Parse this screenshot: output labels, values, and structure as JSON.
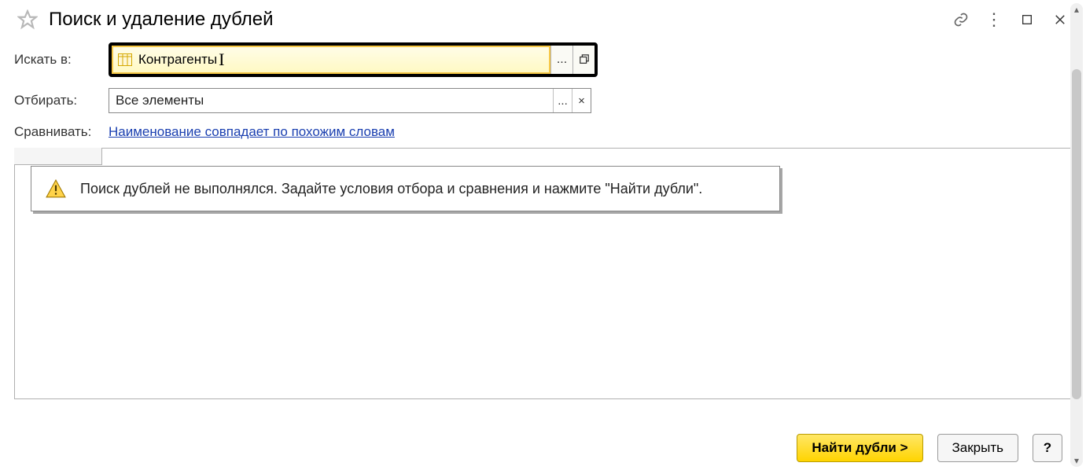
{
  "title": "Поиск и удаление дублей",
  "rows": {
    "search_in": {
      "label": "Искать в:",
      "value": "Контрагенты"
    },
    "filter": {
      "label": "Отбирать:",
      "value": "Все элементы"
    },
    "compare": {
      "label": "Сравнивать:",
      "link": "Наименование совпадает по похожим словам"
    }
  },
  "info_message": "Поиск дублей не выполнялся.  Задайте условия отбора и сравнения и нажмите \"Найти дубли\".",
  "buttons": {
    "find": "Найти дубли >",
    "close": "Закрыть",
    "help": "?"
  },
  "glyphs": {
    "ellipsis": "...",
    "popout": "⧉",
    "clear": "×",
    "kebab": "⋮",
    "maximize": "☐",
    "close_x": "✕",
    "link": "🔗",
    "up": "▴",
    "down": "▾"
  }
}
